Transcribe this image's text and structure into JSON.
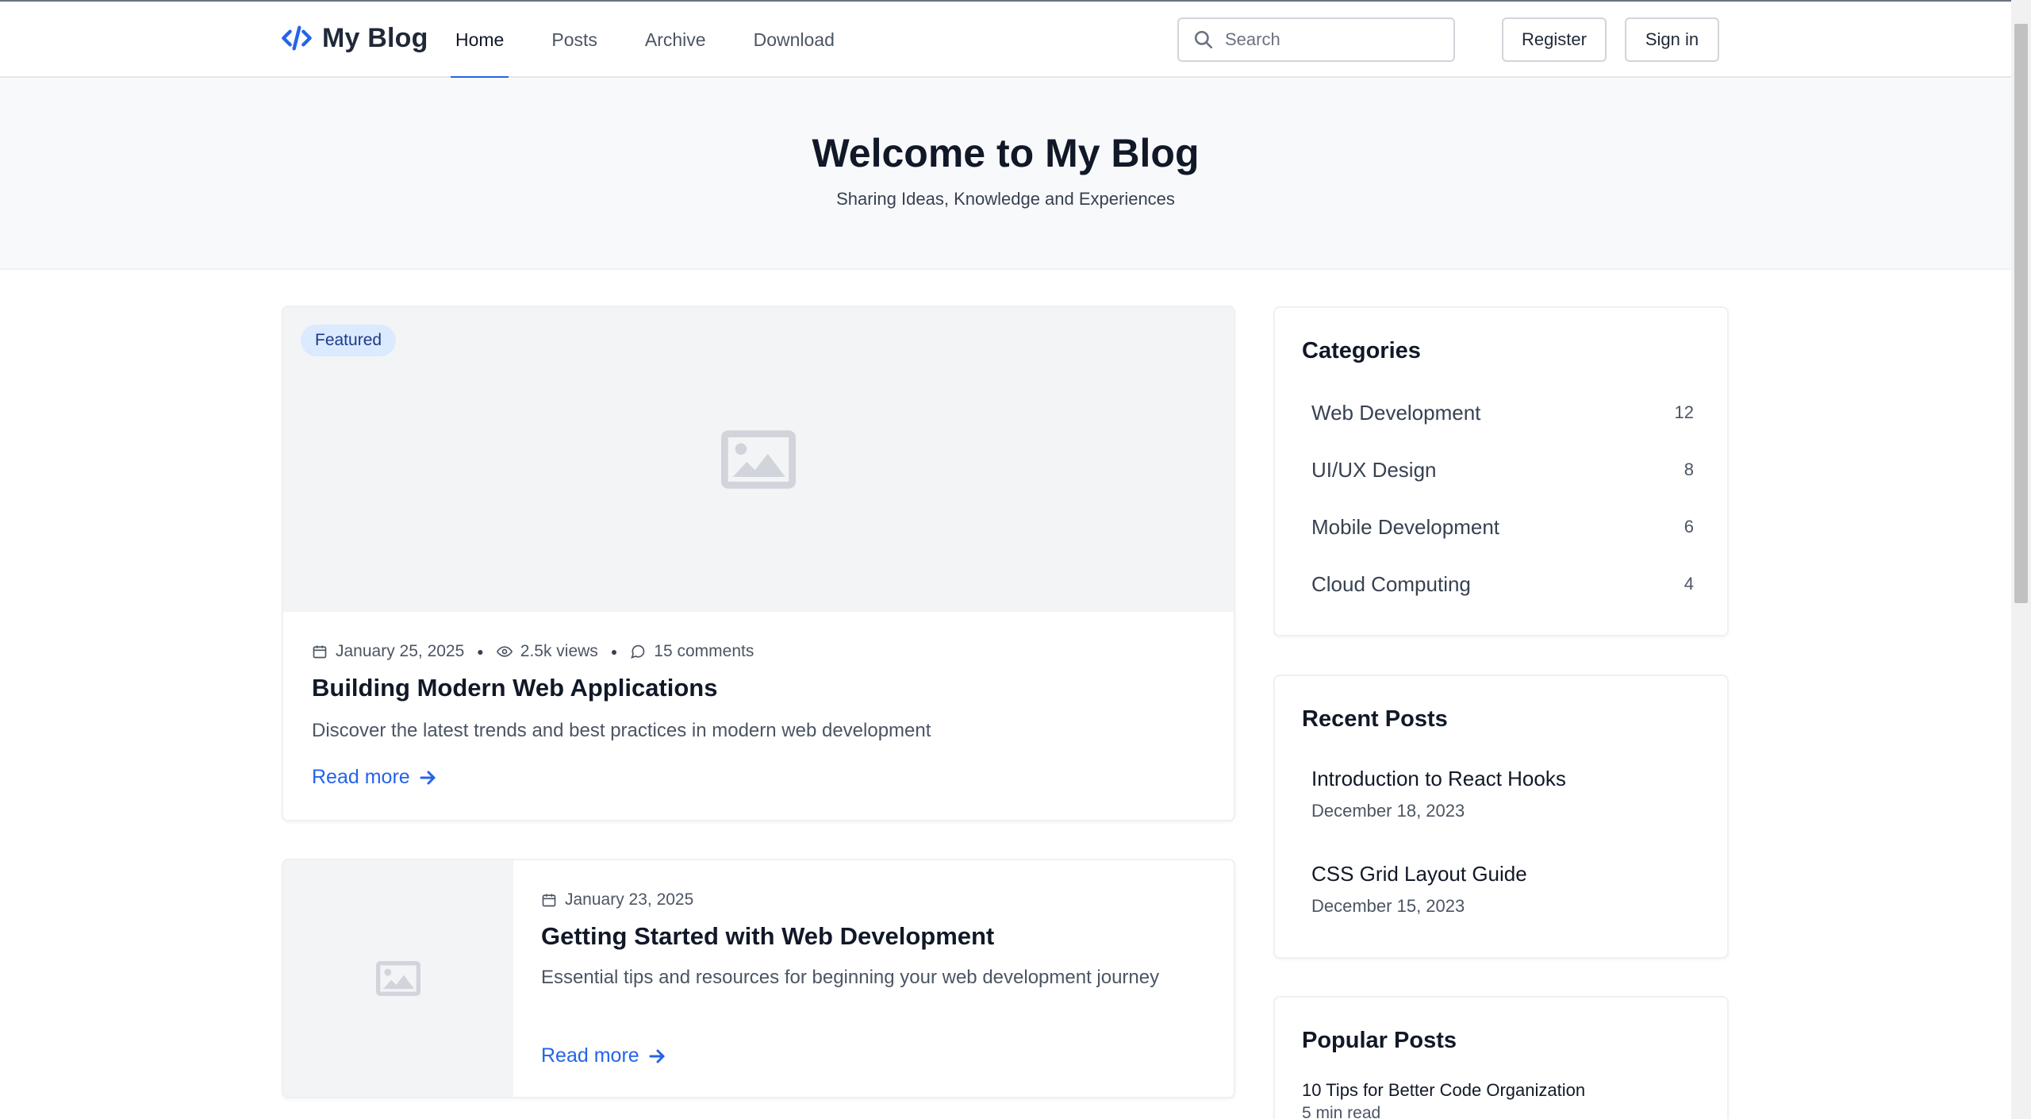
{
  "header": {
    "brand": "My Blog",
    "nav": [
      {
        "label": "Home",
        "active": true
      },
      {
        "label": "Posts",
        "active": false
      },
      {
        "label": "Archive",
        "active": false
      },
      {
        "label": "Download",
        "active": false
      }
    ],
    "search_placeholder": "Search",
    "register_label": "Register",
    "signin_label": "Sign in"
  },
  "hero": {
    "title": "Welcome to My Blog",
    "subtitle": "Sharing Ideas, Knowledge and Experiences"
  },
  "featured_post": {
    "badge": "Featured",
    "date": "January 25, 2025",
    "views": "2.5k views",
    "comments": "15 comments",
    "title": "Building Modern Web Applications",
    "description": "Discover the latest trends and best practices in modern web development",
    "read_more": "Read more"
  },
  "second_post": {
    "date": "January 23, 2025",
    "title": "Getting Started with Web Development",
    "description": "Essential tips and resources for beginning your web development journey",
    "read_more": "Read more"
  },
  "sidebar": {
    "categories_heading": "Categories",
    "categories": [
      {
        "name": "Web Development",
        "count": "12"
      },
      {
        "name": "UI/UX Design",
        "count": "8"
      },
      {
        "name": "Mobile Development",
        "count": "6"
      },
      {
        "name": "Cloud Computing",
        "count": "4"
      }
    ],
    "recent_heading": "Recent Posts",
    "recent": [
      {
        "title": "Introduction to React Hooks",
        "date": "December 18, 2023"
      },
      {
        "title": "CSS Grid Layout Guide",
        "date": "December 15, 2023"
      }
    ],
    "popular_heading": "Popular Posts",
    "popular": [
      {
        "title": "10 Tips for Better Code Organization",
        "meta": "5 min read"
      }
    ]
  },
  "colors": {
    "accent": "#2563eb",
    "badge_bg": "#dbeafe",
    "hero_bg": "#f8f9fb"
  },
  "icons": [
    "code-icon",
    "search-icon",
    "image-icon",
    "calendar-icon",
    "eye-icon",
    "comment-icon",
    "arrow-right-icon"
  ]
}
